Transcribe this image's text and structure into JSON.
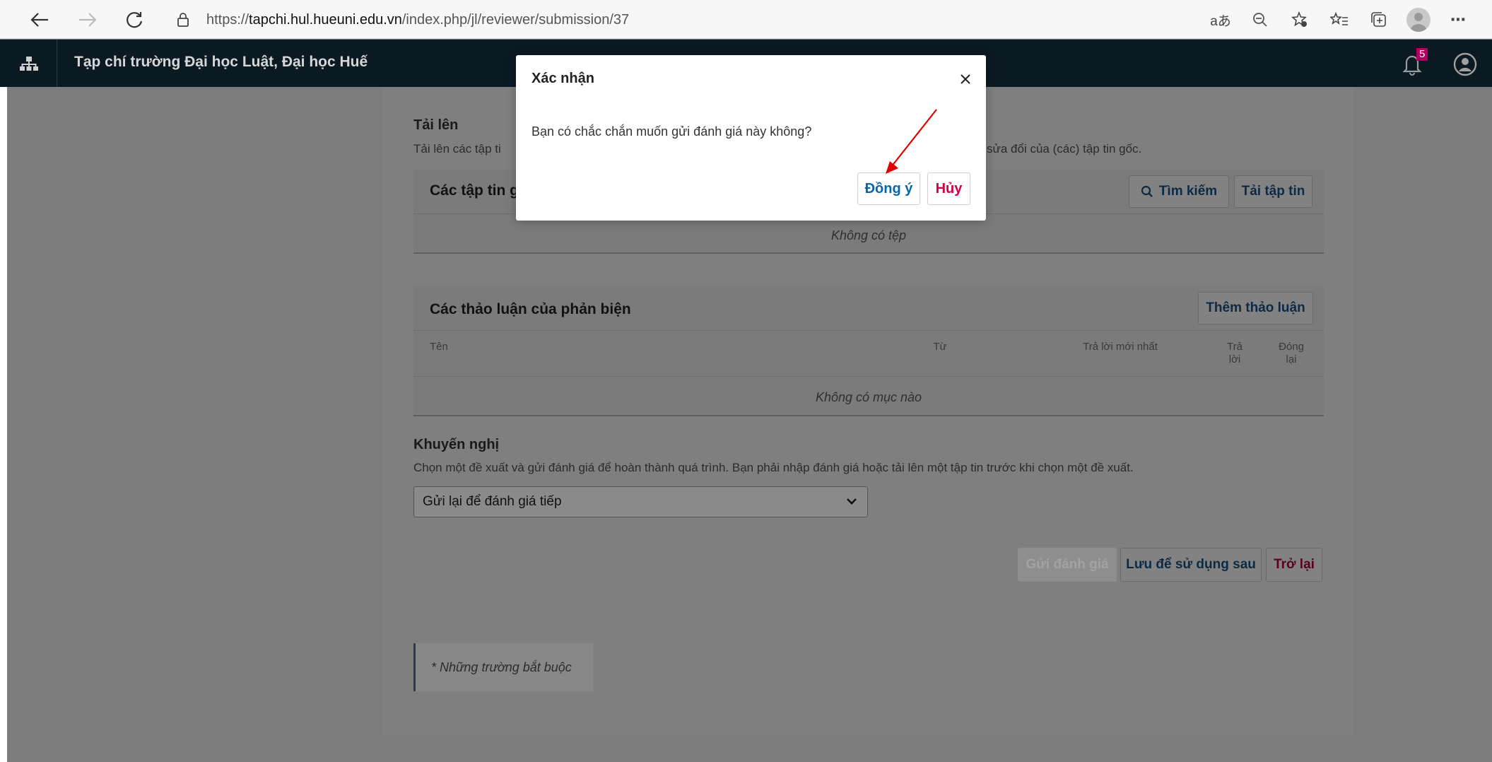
{
  "browser": {
    "url_prefix": "https://",
    "url_host": "tapchi.hul.hueuni.edu.vn",
    "url_path": "/index.php/jl/reviewer/submission/37",
    "read_aloud_icon": "aあ"
  },
  "header": {
    "site_title": "Tạp chí trường Đại học Luật, Đại học Huế",
    "notification_count": "5"
  },
  "upload": {
    "title": "Tải lên",
    "desc_start": "Tải lên các tập ti",
    "desc_end": "sửa đổi của (các) tập tin gốc.",
    "panel_title": "Các tập tin g",
    "search_label": "Tìm kiếm",
    "upload_label": "Tải tập tin",
    "empty": "Không có tệp"
  },
  "discussions": {
    "title": "Các thảo luận của phản biện",
    "add_label": "Thêm thảo luận",
    "columns": {
      "name": "Tên",
      "from": "Từ",
      "last_reply": "Trả lời mới nhất",
      "replies_1": "Trả",
      "replies_2": "lời",
      "closed_1": "Đóng",
      "closed_2": "lại"
    },
    "empty": "Không có mục nào"
  },
  "recommendation": {
    "title": "Khuyến nghị",
    "desc": "Chọn một đề xuất và gửi đánh giá để hoàn thành quá trình. Bạn phải nhập đánh giá hoặc tải lên một tập tin trước khi chọn một đề xuất.",
    "selected": "Gửi lại để đánh giá tiếp"
  },
  "actions": {
    "submit": "Gửi đánh giá",
    "save": "Lưu để sử dụng sau",
    "back": "Trở lại"
  },
  "required_note": "* Những trường bắt buộc",
  "modal": {
    "title": "Xác nhận",
    "message": "Bạn có chắc chắn muốn gửi đánh giá này không?",
    "ok": "Đồng ý",
    "cancel": "Hủy"
  },
  "colors": {
    "header_bg": "#0b1923",
    "overlay": "#7f7f7f",
    "ok_blue": "#0a66a8",
    "cancel_red": "#d00049",
    "annotation_arrow": "#e00000"
  }
}
